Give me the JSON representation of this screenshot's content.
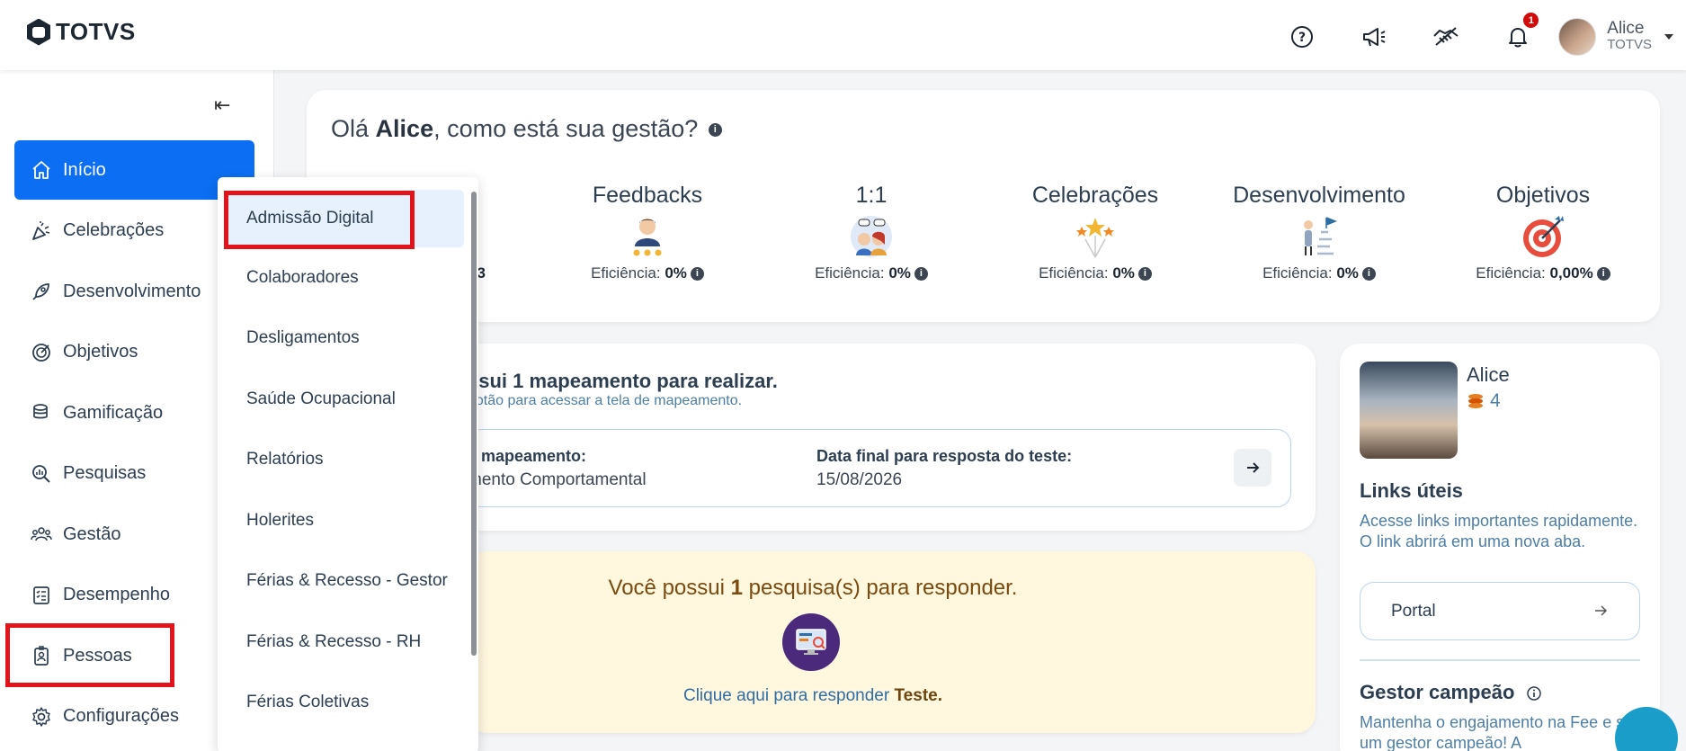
{
  "brand": "TOTVS",
  "user": {
    "name": "Alice",
    "company": "TOTVS",
    "notifications": "1"
  },
  "sidebar": {
    "items": [
      {
        "label": "Início"
      },
      {
        "label": "Celebrações"
      },
      {
        "label": "Desenvolvimento"
      },
      {
        "label": "Objetivos"
      },
      {
        "label": "Gamificação"
      },
      {
        "label": "Pesquisas"
      },
      {
        "label": "Gestão"
      },
      {
        "label": "Desempenho"
      },
      {
        "label": "Pessoas"
      },
      {
        "label": "Configurações"
      }
    ]
  },
  "dropdown": {
    "items": [
      {
        "label": "Admissão Digital"
      },
      {
        "label": "Colaboradores"
      },
      {
        "label": "Desligamentos"
      },
      {
        "label": "Saúde Ocupacional"
      },
      {
        "label": "Relatórios"
      },
      {
        "label": "Holerites"
      },
      {
        "label": "Férias & Recesso - Gestor"
      },
      {
        "label": "Férias & Recesso - RH"
      },
      {
        "label": "Férias Coletivas"
      }
    ]
  },
  "welcome": {
    "greeting": "Olá",
    "name": "Alice",
    "question": ", como está sua gestão?"
  },
  "metrics": [
    {
      "title": "Feedbacks",
      "eff_label": "Eficiência:",
      "eff_value": "0%"
    },
    {
      "title": "1:1",
      "eff_label": "Eficiência:",
      "eff_value": "0%"
    },
    {
      "title": "Celebrações",
      "eff_label": "Eficiência:",
      "eff_value": "0%"
    },
    {
      "title": "Desenvolvimento",
      "eff_label": "Eficiência:",
      "eff_value": "0%"
    },
    {
      "title": "Objetivos",
      "eff_label": "Eficiência:",
      "eff_value": "0,00%"
    }
  ],
  "partial_metric_value": "3",
  "mapping": {
    "title": "ssui 1 mapeamento para realizar.",
    "subtitle": "botão para acessar a tela de mapeamento.",
    "left_label": "e mapeamento:",
    "left_value": "mento Comportamental",
    "right_label": "Data final para resposta do teste:",
    "right_value": "15/08/2026"
  },
  "survey": {
    "pre": "Você possui ",
    "count": "1",
    "post": " pesquisa(s) para responder.",
    "link_pre": "Clique aqui para responder ",
    "link_name": "Teste."
  },
  "profile": {
    "name": "Alice",
    "coins": "4"
  },
  "links": {
    "title": "Links úteis",
    "description": "Acesse links importantes rapidamente. O link abrirá em uma nova aba.",
    "portal": "Portal"
  },
  "gestor": {
    "title": "Gestor campeão",
    "description": "Mantenha o engajamento na Fee e seja um gestor campeão! A"
  }
}
